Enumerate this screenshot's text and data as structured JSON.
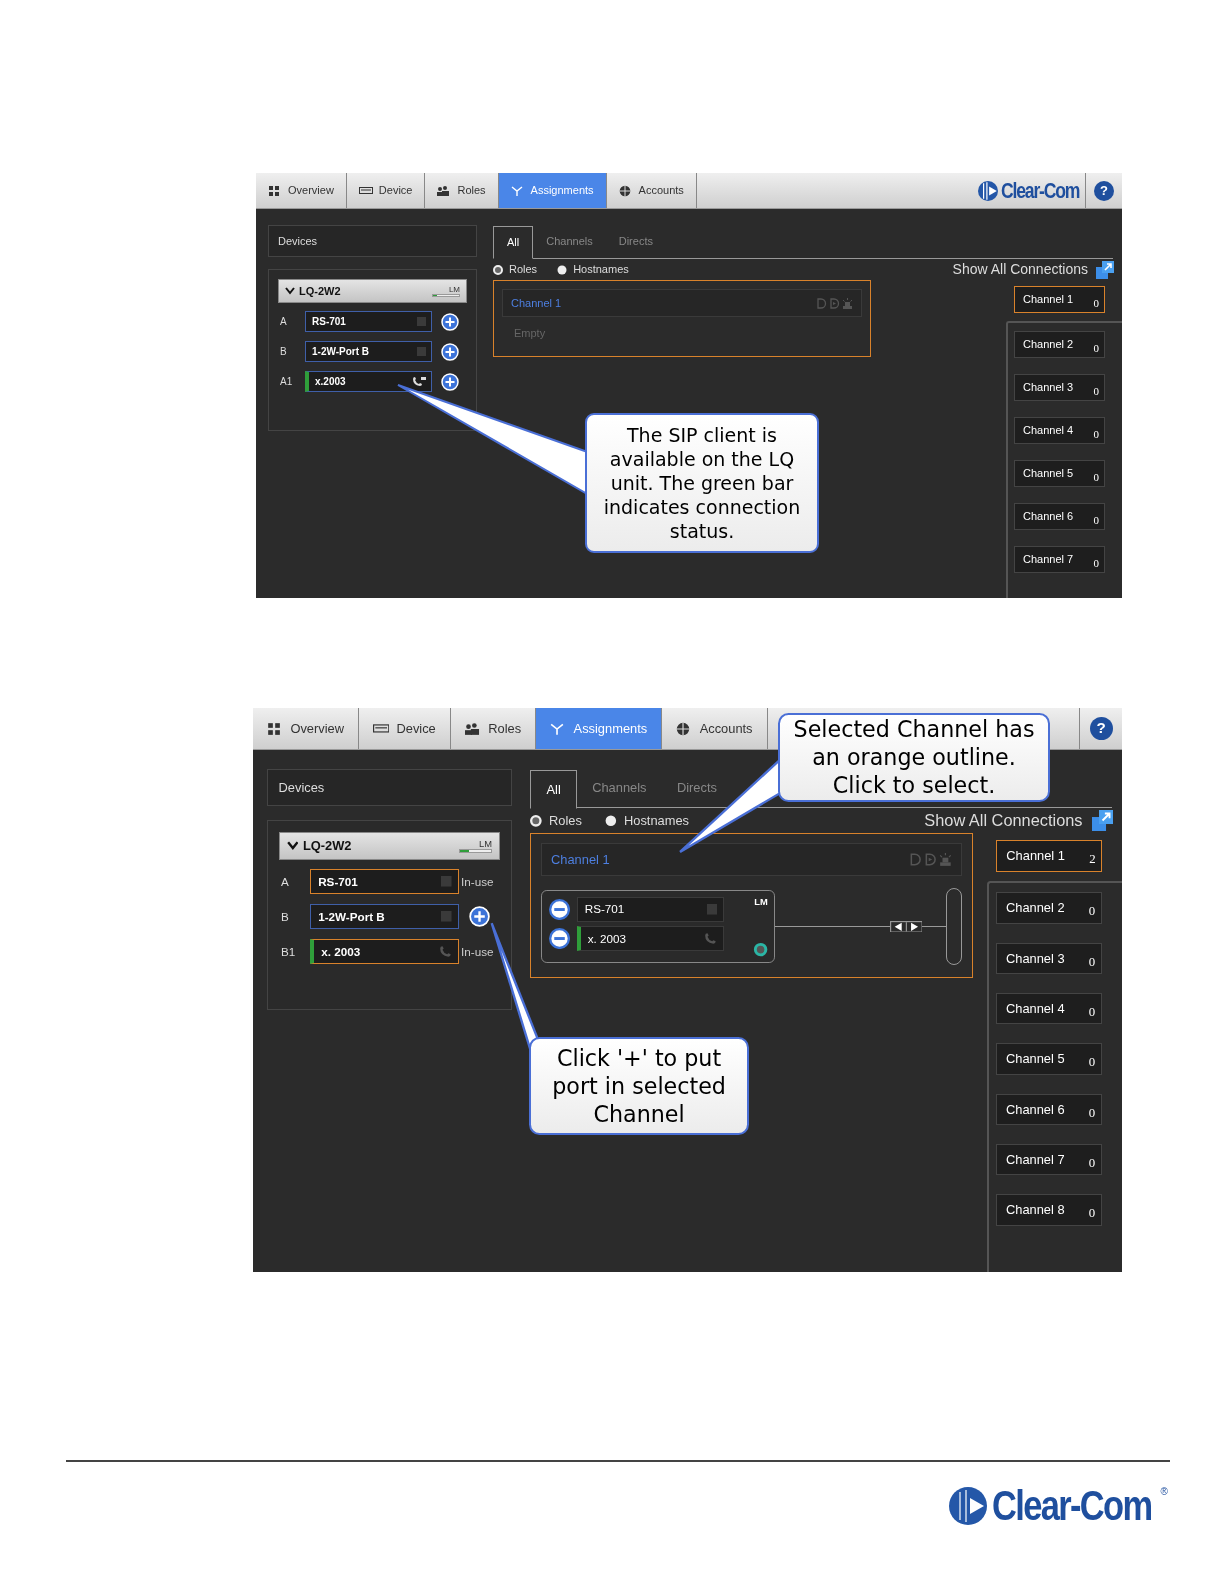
{
  "screenshots": [
    {
      "nav": {
        "tabs": [
          {
            "label": "Overview",
            "selected": false
          },
          {
            "label": "Device",
            "selected": false
          },
          {
            "label": "Roles",
            "selected": false
          },
          {
            "label": "Assignments",
            "selected": true
          },
          {
            "label": "Accounts",
            "selected": false
          }
        ],
        "logo": "Clear-Com",
        "help": "?"
      },
      "devices_header": "Devices",
      "device": {
        "name": "LQ-2W2",
        "expanded": true,
        "meter_label": "LM",
        "level": 0.15,
        "ports": [
          {
            "label": "A",
            "name": "RS-701",
            "kind": "analog",
            "connected": false,
            "in_use": false
          },
          {
            "label": "B",
            "name": "1-2W-Port B",
            "kind": "analog",
            "connected": false,
            "in_use": false
          },
          {
            "label": "A1",
            "name": "x.2003",
            "kind": "sip",
            "connected": true,
            "in_use": false
          }
        ]
      },
      "view_tabs": [
        {
          "label": "All",
          "selected": true
        },
        {
          "label": "Channels",
          "selected": false
        },
        {
          "label": "Directs",
          "selected": false
        }
      ],
      "radios": [
        {
          "label": "Roles",
          "selected": true
        },
        {
          "label": "Hostnames",
          "selected": false
        }
      ],
      "show_all": "Show All Connections",
      "channel_card": {
        "title": "Channel 1",
        "selected": true,
        "empty_text": "Empty"
      },
      "channels": [
        {
          "label": "Channel 1",
          "count": "0",
          "selected": true
        },
        {
          "label": "Channel 2",
          "count": "0",
          "selected": false
        },
        {
          "label": "Channel 3",
          "count": "0",
          "selected": false
        },
        {
          "label": "Channel 4",
          "count": "0",
          "selected": false
        },
        {
          "label": "Channel 5",
          "count": "0",
          "selected": false
        },
        {
          "label": "Channel 6",
          "count": "0",
          "selected": false
        },
        {
          "label": "Channel 7",
          "count": "0",
          "selected": false
        }
      ],
      "callouts": [
        {
          "text": "The SIP client is available on the LQ unit. The green bar indicates connection status."
        }
      ]
    },
    {
      "nav": {
        "tabs": [
          {
            "label": "Overview",
            "selected": false
          },
          {
            "label": "Device",
            "selected": false
          },
          {
            "label": "Roles",
            "selected": false
          },
          {
            "label": "Assignments",
            "selected": true
          },
          {
            "label": "Accounts",
            "selected": false
          }
        ],
        "help": "?"
      },
      "devices_header": "Devices",
      "device": {
        "name": "LQ-2W2",
        "expanded": true,
        "meter_label": "LM",
        "level": 0.3,
        "ports": [
          {
            "label": "A",
            "name": "RS-701",
            "kind": "analog",
            "connected": false,
            "in_use": true,
            "status_label": "In-use"
          },
          {
            "label": "B",
            "name": "1-2W-Port B",
            "kind": "analog",
            "connected": false,
            "in_use": false
          },
          {
            "label": "B1",
            "name": "x. 2003",
            "kind": "sip",
            "connected": true,
            "in_use": true,
            "status_label": "In-use"
          }
        ]
      },
      "view_tabs": [
        {
          "label": "All",
          "selected": true
        },
        {
          "label": "Channels",
          "selected": false
        },
        {
          "label": "Directs",
          "selected": false
        }
      ],
      "radios": [
        {
          "label": "Roles",
          "selected": true
        },
        {
          "label": "Hostnames",
          "selected": false
        }
      ],
      "show_all": "Show All Connections",
      "channel_card": {
        "title": "Channel 1",
        "selected": true,
        "meter_label": "LM",
        "members": [
          {
            "name": "RS-701",
            "kind": "analog",
            "connected": false
          },
          {
            "name": "x. 2003",
            "kind": "sip",
            "connected": true
          }
        ]
      },
      "channels": [
        {
          "label": "Channel 1",
          "count": "2",
          "selected": true
        },
        {
          "label": "Channel 2",
          "count": "0",
          "selected": false
        },
        {
          "label": "Channel 3",
          "count": "0",
          "selected": false
        },
        {
          "label": "Channel 4",
          "count": "0",
          "selected": false
        },
        {
          "label": "Channel 5",
          "count": "0",
          "selected": false
        },
        {
          "label": "Channel 6",
          "count": "0",
          "selected": false
        },
        {
          "label": "Channel 7",
          "count": "0",
          "selected": false
        },
        {
          "label": "Channel 8",
          "count": "0",
          "selected": false
        }
      ],
      "callouts": [
        {
          "text": "Selected Channel has an orange outline. Click to select."
        },
        {
          "text": "Click '+' to put port in selected Channel"
        }
      ]
    }
  ],
  "footer": {
    "logo": "Clear-Com",
    "mark": "®"
  }
}
